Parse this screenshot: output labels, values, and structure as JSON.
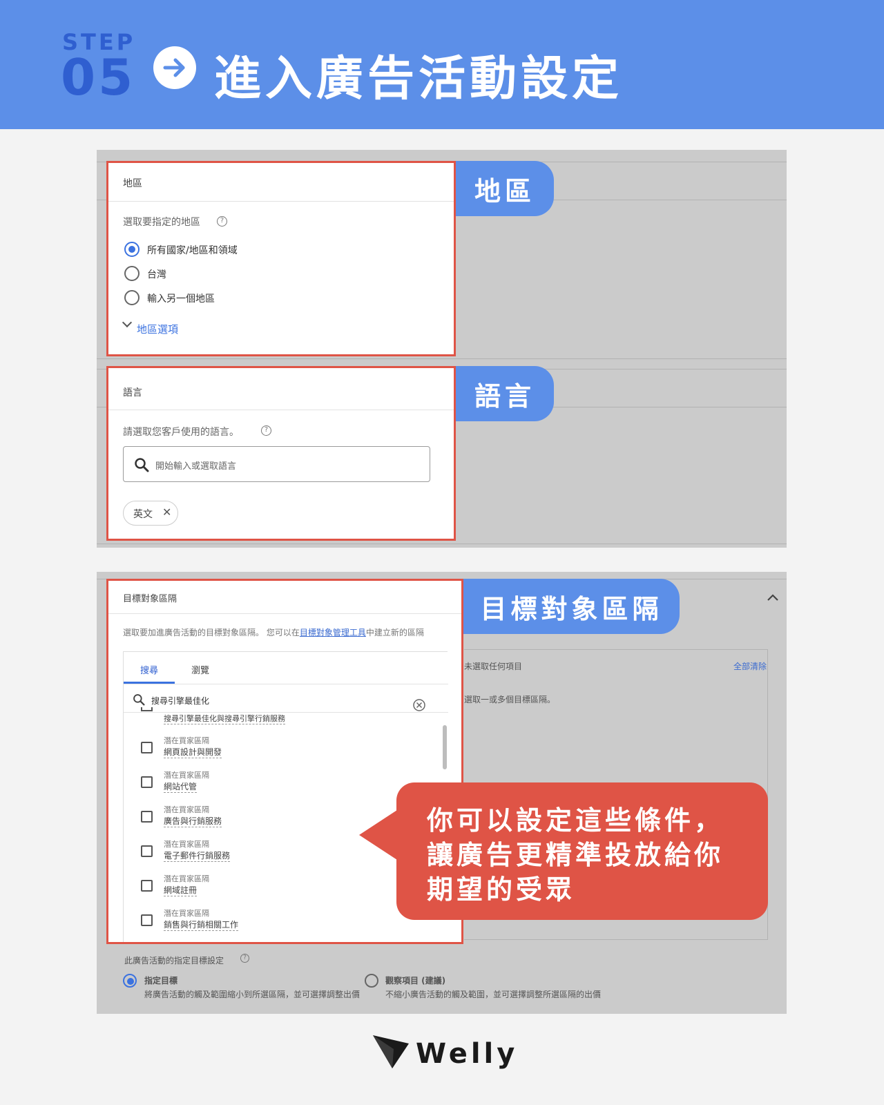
{
  "header": {
    "step_label": "STEP",
    "step_number": "05",
    "title": "進入廣告活動設定"
  },
  "region": {
    "tag": "地區",
    "section_title": "地區",
    "question": "選取要指定的地區",
    "options": [
      "所有國家/地區和領域",
      "台灣",
      "輸入另一個地區"
    ],
    "selected_option": "所有國家/地區和領域",
    "more_link": "地區選項"
  },
  "language": {
    "tag": "語言",
    "section_title": "語言",
    "question": "請選取您客戶使用的語言。",
    "search_placeholder": "開始輸入或選取語言",
    "chip": "英文"
  },
  "audience": {
    "tag": "目標對象區隔",
    "section_title": "目標對象區隔",
    "description_pre": "選取要加進廣告活動的目標對象區隔。 您可以在",
    "description_link": "目標對象管理工具",
    "description_post": "中建立新的區隔",
    "tabs": [
      "搜尋",
      "瀏覽"
    ],
    "active_tab": "搜尋",
    "search_value": "搜尋引擎最佳化",
    "partial_item": "搜尋引擎最佳化與搜尋引擎行銷服務",
    "items": [
      {
        "category": "潛在買家區隔",
        "name": "網頁設計與開發"
      },
      {
        "category": "潛在買家區隔",
        "name": "網站代管"
      },
      {
        "category": "潛在買家區隔",
        "name": "廣告與行銷服務"
      },
      {
        "category": "潛在買家區隔",
        "name": "電子郵件行銷服務"
      },
      {
        "category": "潛在買家區隔",
        "name": "網域註冊"
      },
      {
        "category": "潛在買家區隔",
        "name": "銷售與行銷相關工作"
      }
    ],
    "selected_header": "未選取任何項目",
    "clear_all": "全部清除",
    "selected_hint": "選取一或多個目標區隔。",
    "setting_title": "此廣告活動的指定目標設定",
    "setting_options": [
      {
        "label": "指定目標",
        "desc": "將廣告活動的觸及範圍縮小到所選區隔，並可選擇調整出價"
      },
      {
        "label": "觀察項目 (建議)",
        "desc": "不縮小廣告活動的觸及範圍，並可選擇調整所選區隔的出價"
      }
    ]
  },
  "callout": {
    "lines": [
      "你可以設定這些條件，",
      "讓廣告更精準投放給你",
      "期望的受眾"
    ]
  },
  "logo": {
    "text": "Welly",
    "icon": "paper-plane-icon"
  },
  "colors": {
    "header_blue": "#5c8fe8",
    "step_blue": "#2f5fd0",
    "highlight_red": "#df5446",
    "link_blue": "#3b72e0"
  }
}
